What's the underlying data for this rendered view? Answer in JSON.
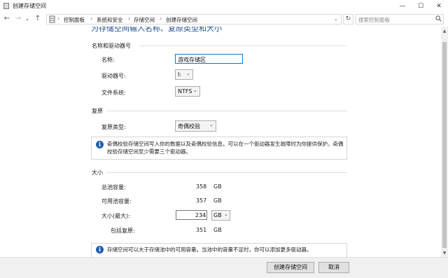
{
  "window": {
    "title": "创建存储空间",
    "controls": {
      "minimize": "—",
      "maximize": "☐",
      "close": "✕"
    }
  },
  "nav": {
    "back": "←",
    "forward": "→",
    "recent": "⌄",
    "up": "↑",
    "breadcrumb": [
      "控制面板",
      "系统和安全",
      "存储空间",
      "创建存储空间"
    ],
    "breadcrumb_sep": "›",
    "refresh": "↻",
    "search_placeholder": "搜索控制面板"
  },
  "heading_partial": "为存储空间输入名称、复原类型和大小",
  "sections": {
    "name_drive": {
      "title": "名称和驱动器号",
      "name_label": "名称:",
      "name_value": "游戏存储区",
      "drive_label": "驱动器号:",
      "drive_value": "I:",
      "fs_label": "文件系统:",
      "fs_value": "NTFS"
    },
    "resiliency": {
      "title": "复原",
      "type_label": "复原类型:",
      "type_value": "奇偶校验",
      "info_line1": "奇偶校验存储空间写入你的数据以及奇偶校验信息。可以在一个驱动器发生故障时为你提供保护。奇偶",
      "info_line2": "校验存储空间至少需要三个驱动器。"
    },
    "size": {
      "title": "大小",
      "total_label": "总池容量:",
      "total_value": "358",
      "total_unit": "GB",
      "avail_label": "可用池容量:",
      "avail_value": "357",
      "avail_unit": "GB",
      "max_label": "大小(最大):",
      "max_value": "234",
      "max_unit": "GB",
      "incl_label": "包括复原:",
      "incl_value": "351",
      "incl_unit": "GB",
      "info": "存储空间可以大于存储池中的可用容量。当池中的容量不足时，你可以添加更多驱动器。"
    }
  },
  "footer": {
    "create_button": "创建存储空间",
    "cancel_button": "取消"
  },
  "icons": {
    "info": "i",
    "dropdown": "⌄"
  }
}
